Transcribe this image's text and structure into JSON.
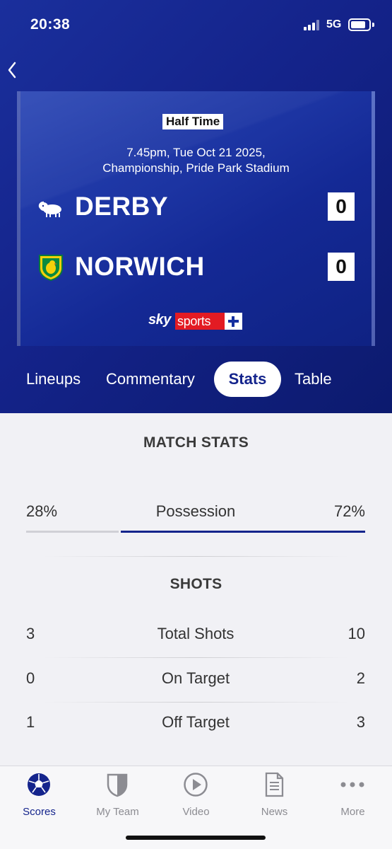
{
  "status_bar": {
    "time": "20:38",
    "network": "5G"
  },
  "match": {
    "status_badge": "Half Time",
    "info_line1": "7.45pm, Tue Oct 21 2025,",
    "info_line2": "Championship, Pride Park Stadium",
    "home": {
      "name": "DERBY",
      "score": "0",
      "crest": "ram-crest-icon"
    },
    "away": {
      "name": "NORWICH",
      "score": "0",
      "crest": "canary-crest-icon"
    },
    "broadcaster": {
      "sky": "sky",
      "sports": "sports",
      "plus": "+"
    }
  },
  "tabs": [
    {
      "label": "Lineups",
      "active": false
    },
    {
      "label": "Commentary",
      "active": false
    },
    {
      "label": "Stats",
      "active": true
    },
    {
      "label": "Table",
      "active": false
    }
  ],
  "stats": {
    "match_stats_title": "MATCH STATS",
    "possession": {
      "label": "Possession",
      "home": "28%",
      "away": "72%",
      "home_fraction": 0.28,
      "away_fraction": 0.72
    },
    "shots_title": "SHOTS",
    "rows": [
      {
        "label": "Total Shots",
        "home": "3",
        "away": "10"
      },
      {
        "label": "On Target",
        "home": "0",
        "away": "2"
      },
      {
        "label": "Off Target",
        "home": "1",
        "away": "3"
      }
    ]
  },
  "tab_bar": [
    {
      "label": "Scores",
      "icon": "football-icon",
      "active": true
    },
    {
      "label": "My Team",
      "icon": "shield-icon",
      "active": false
    },
    {
      "label": "Video",
      "icon": "play-icon",
      "active": false
    },
    {
      "label": "News",
      "icon": "document-icon",
      "active": false
    },
    {
      "label": "More",
      "icon": "more-icon",
      "active": false
    }
  ],
  "colors": {
    "brand_blue": "#14248c",
    "sky_red": "#e31b23",
    "possession_home": "#d0d0d6",
    "possession_away": "#14248c"
  }
}
